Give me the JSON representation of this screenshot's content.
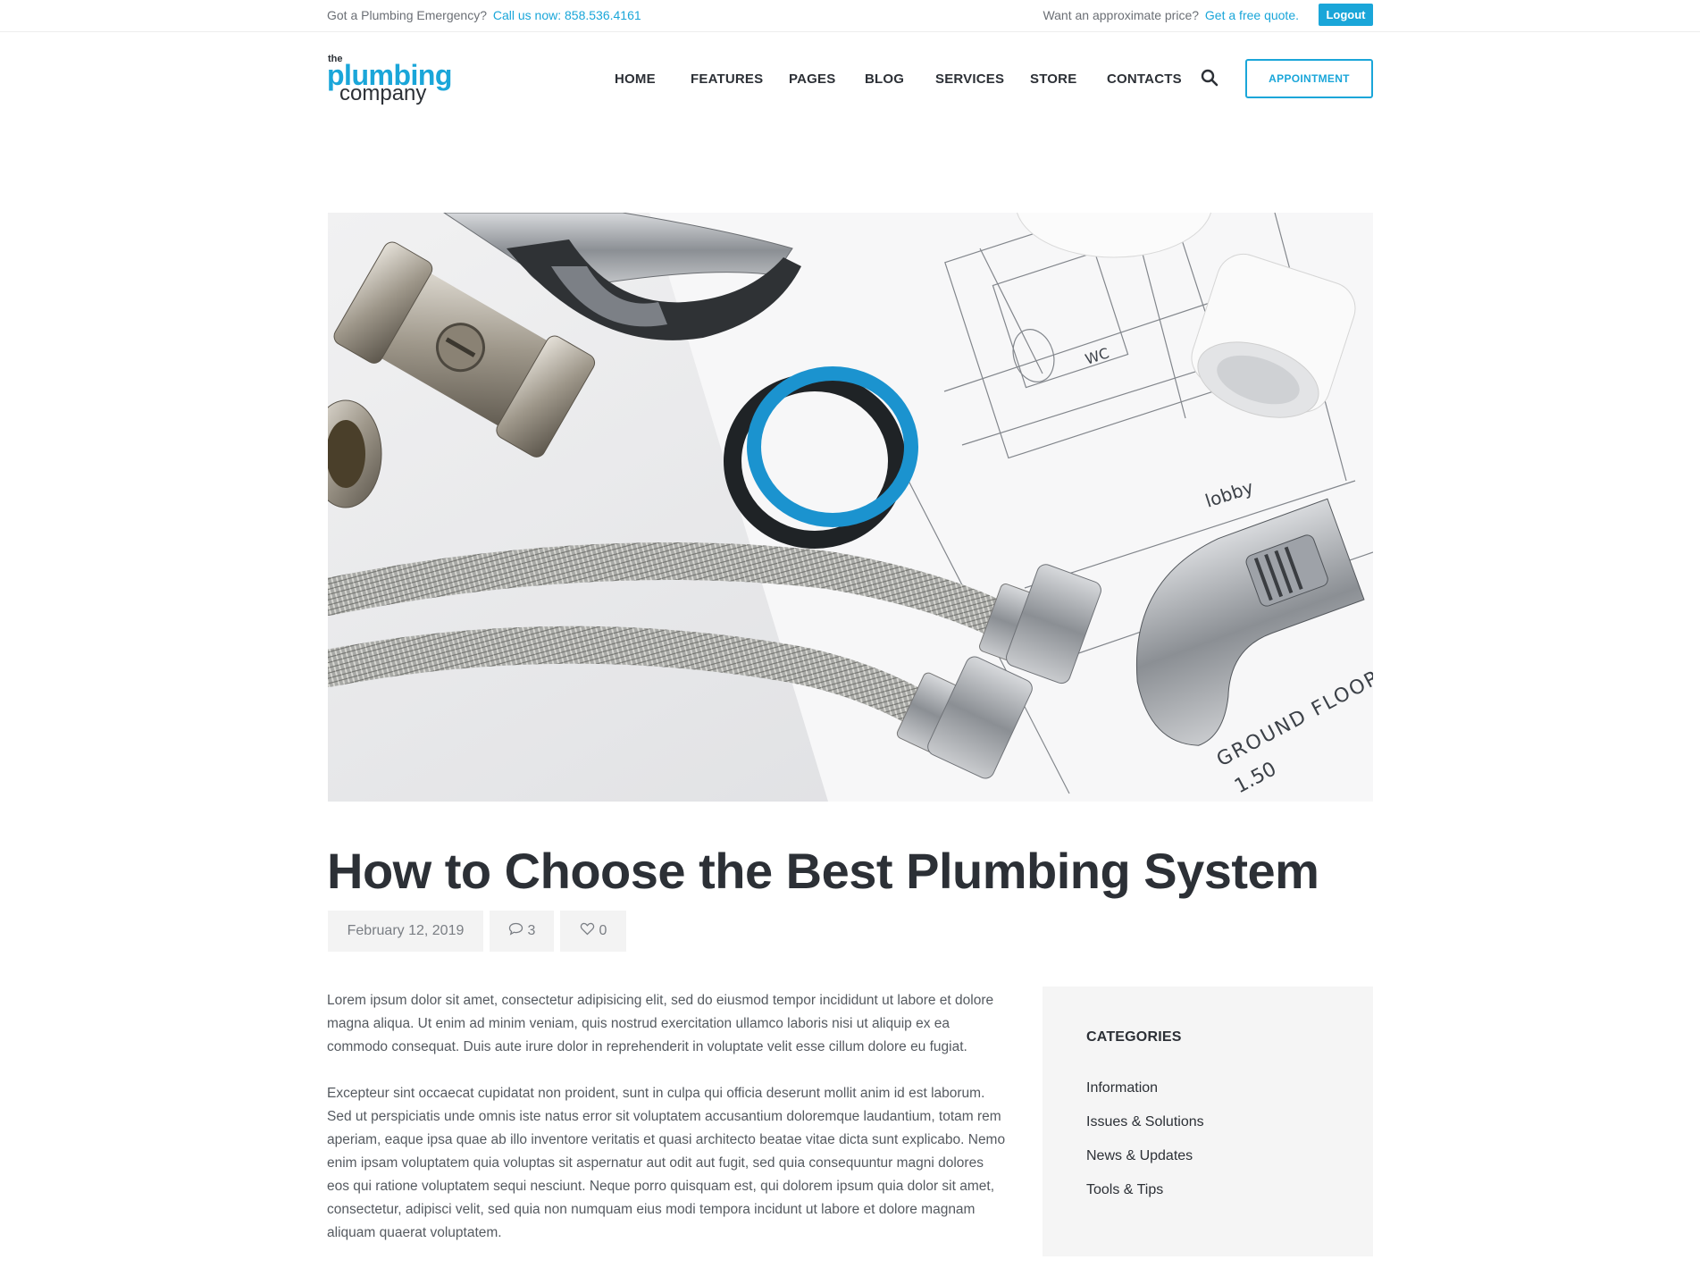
{
  "topbar": {
    "emergency_text": "Got a Plumbing Emergency?",
    "phone_link": "Call us now: 858.536.4161",
    "price_text": "Want an approximate price?",
    "quote_link": "Get a free quote.",
    "logout_label": "Logout"
  },
  "logo": {
    "the": "the",
    "plumbing": "plumbing",
    "company": "company"
  },
  "nav": {
    "items": [
      "HOME",
      "FEATURES",
      "PAGES",
      "BLOG",
      "SERVICES",
      "STORE",
      "CONTACTS"
    ],
    "appointment_label": "APPOINTMENT"
  },
  "hero": {
    "icon": "plumbing-tools-photo",
    "drawing_labels": [
      "lobby",
      "WC",
      "GROUND FLOOR",
      "1.50"
    ]
  },
  "post": {
    "title": "How to Choose the Best Plumbing System",
    "date": "February 12, 2019",
    "comments": "3",
    "likes": "0",
    "paragraphs": [
      "Lorem ipsum dolor sit amet, consectetur adipisicing elit, sed do eiusmod tempor incididunt ut labore et dolore magna aliqua. Ut enim ad minim veniam, quis nostrud exercitation ullamco laboris nisi ut aliquip ex ea commodo consequat. Duis aute irure dolor in reprehenderit in voluptate velit esse cillum dolore eu fugiat.",
      "Excepteur sint occaecat cupidatat non proident, sunt in culpa qui officia deserunt mollit anim id est laborum. Sed ut perspiciatis unde omnis iste natus error sit voluptatem accusantium doloremque laudantium, totam rem aperiam, eaque ipsa quae ab illo inventore veritatis et quasi architecto beatae vitae dicta sunt explicabo. Nemo enim ipsam voluptatem quia voluptas sit aspernatur aut odit aut fugit, sed quia consequuntur magni dolores eos qui ratione voluptatem sequi nesciunt. Neque porro quisquam est, qui dolorem ipsum quia dolor sit amet, consectetur, adipisci velit, sed quia non numquam eius modi tempora incidunt ut labore et dolore magnam aliquam quaerat voluptatem."
    ]
  },
  "sidebar": {
    "categories_title": "CATEGORIES",
    "categories": [
      "Information",
      "Issues & Solutions",
      "News & Updates",
      "Tools & Tips"
    ]
  },
  "colors": {
    "accent": "#1aa6d9",
    "text_dark": "#2c3036",
    "meta_bg": "#f3f3f3",
    "sidebar_bg": "#f5f5f5"
  }
}
